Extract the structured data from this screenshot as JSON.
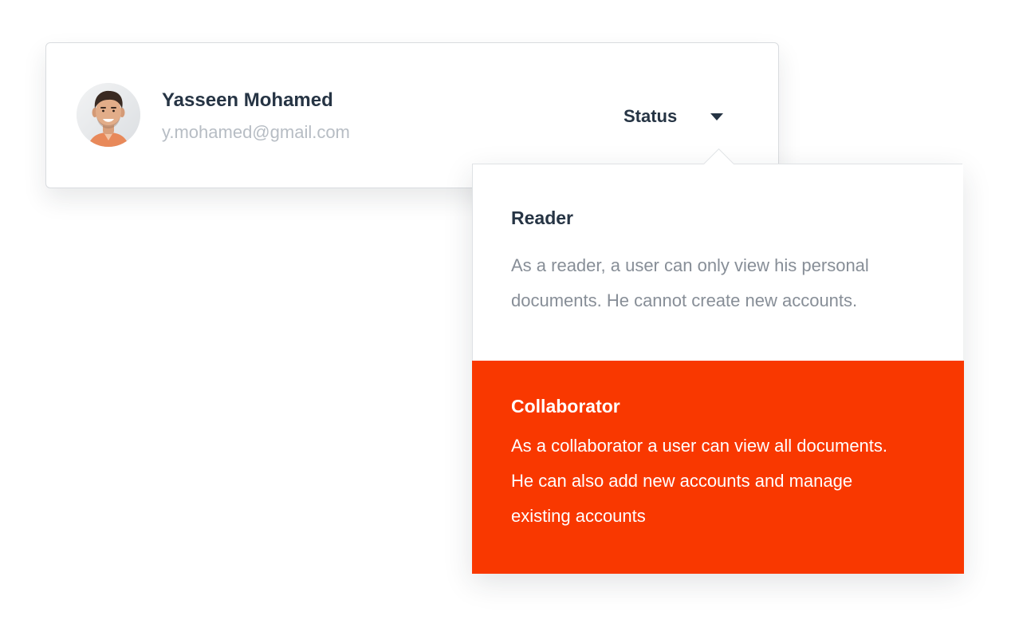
{
  "user": {
    "name": "Yasseen Mohamed",
    "email": "y.mohamed@gmail.com",
    "avatar": "avatar-photo"
  },
  "status": {
    "label": "Status",
    "icon": "caret-down-icon"
  },
  "dropdown": {
    "options": [
      {
        "title": "Reader",
        "description": "As a reader, a user can only view his personal\ndocuments. He cannot create new accounts.",
        "selected": false
      },
      {
        "title": "Collaborator",
        "description": "As a collaborator a user can view all documents.\nHe can also add new accounts and manage\nexisting accounts",
        "selected": true
      }
    ]
  },
  "colors": {
    "accent": "#f93800",
    "text_dark": "#263444",
    "text_muted": "#878e97",
    "email": "#b7bdc4"
  }
}
